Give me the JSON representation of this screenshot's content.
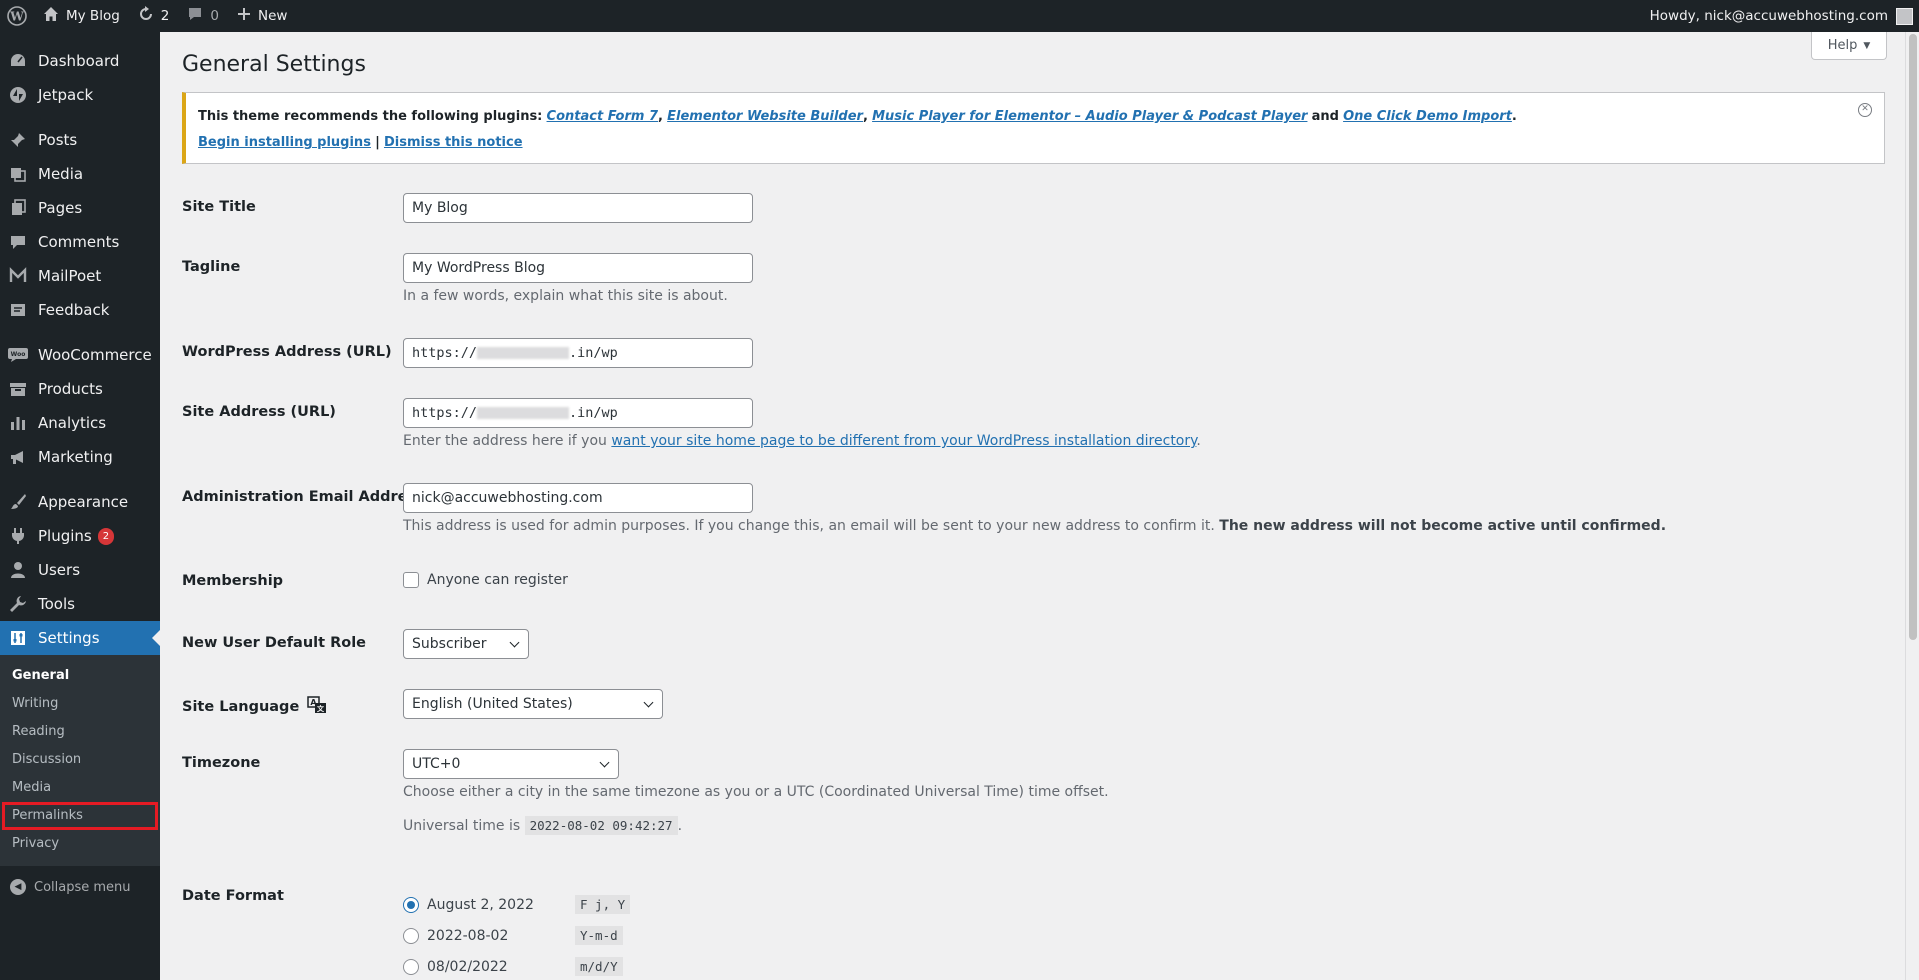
{
  "adminbar": {
    "site_name": "My Blog",
    "updates_count": "2",
    "comments_count": "0",
    "new_label": "New",
    "howdy": "Howdy, nick@accuwebhosting.com"
  },
  "sidebar": {
    "items": [
      {
        "label": "Dashboard"
      },
      {
        "label": "Jetpack"
      },
      {
        "label": "Posts"
      },
      {
        "label": "Media"
      },
      {
        "label": "Pages"
      },
      {
        "label": "Comments"
      },
      {
        "label": "MailPoet"
      },
      {
        "label": "Feedback"
      },
      {
        "label": "WooCommerce"
      },
      {
        "label": "Products"
      },
      {
        "label": "Analytics"
      },
      {
        "label": "Marketing"
      },
      {
        "label": "Appearance"
      },
      {
        "label": "Plugins",
        "badge": "2"
      },
      {
        "label": "Users"
      },
      {
        "label": "Tools"
      },
      {
        "label": "Settings"
      }
    ],
    "submenu": [
      "General",
      "Writing",
      "Reading",
      "Discussion",
      "Media",
      "Permalinks",
      "Privacy"
    ],
    "collapse_label": "Collapse menu"
  },
  "page": {
    "title": "General Settings",
    "help_label": "Help"
  },
  "notice": {
    "prefix": "This theme recommends the following plugins:",
    "plugin1": "Contact Form 7",
    "plugin2": "Elementor Website Builder",
    "plugin3": "Music Player for Elementor – Audio Player & Podcast Player",
    "and": "and",
    "plugin4": "One Click Demo Import",
    "begin": "Begin installing plugins",
    "sep": "|",
    "dismiss": "Dismiss this notice"
  },
  "form": {
    "site_title_label": "Site Title",
    "site_title_value": "My Blog",
    "tagline_label": "Tagline",
    "tagline_value": "My WordPress Blog",
    "tagline_desc": "In a few words, explain what this site is about.",
    "wp_address_label": "WordPress Address (URL)",
    "wp_address_prefix": "https://",
    "wp_address_suffix": ".in/wp",
    "site_address_label": "Site Address (URL)",
    "site_address_prefix": "https://",
    "site_address_suffix": ".in/wp",
    "site_address_desc_pre": "Enter the address here if you",
    "site_address_desc_link": "want your site home page to be different from your WordPress installation directory",
    "site_address_desc_post": ".",
    "email_label": "Administration Email Address",
    "email_value": "nick@accuwebhosting.com",
    "email_desc": "This address is used for admin purposes. If you change this, an email will be sent to your new address to confirm it.",
    "email_desc_bold": "The new address will not become active until confirmed.",
    "membership_label": "Membership",
    "membership_check": "Anyone can register",
    "role_label": "New User Default Role",
    "role_value": "Subscriber",
    "language_label": "Site Language",
    "language_value": "English (United States)",
    "timezone_label": "Timezone",
    "timezone_value": "UTC+0",
    "timezone_desc": "Choose either a city in the same timezone as you or a UTC (Coordinated Universal Time) time offset.",
    "universal_pre": "Universal time is",
    "universal_time": "2022-08-02 09:42:27",
    "universal_post": ".",
    "date_format_label": "Date Format",
    "date_options": [
      {
        "label": "August 2, 2022",
        "code": "F j, Y"
      },
      {
        "label": "2022-08-02",
        "code": "Y-m-d"
      },
      {
        "label": "08/02/2022",
        "code": "m/d/Y"
      }
    ]
  }
}
